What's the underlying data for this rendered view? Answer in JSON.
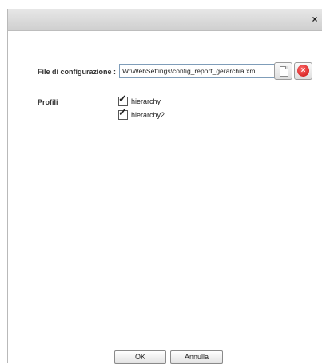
{
  "dialog": {
    "close_symbol": "×"
  },
  "config": {
    "label": "File di configurazione :",
    "path_value": "W:\\WebSettings\\config_report_gerarchia.xml",
    "new_icon": "new-document-icon",
    "remove_icon": "remove-icon",
    "remove_symbol": "×"
  },
  "profiles": {
    "label": "Profili",
    "items": [
      {
        "label": "hierarchy",
        "checked": true
      },
      {
        "label": "hierarchy2",
        "checked": true
      }
    ],
    "check_mark": "✓"
  },
  "buttons": {
    "ok": "OK",
    "cancel": "Annulla"
  }
}
